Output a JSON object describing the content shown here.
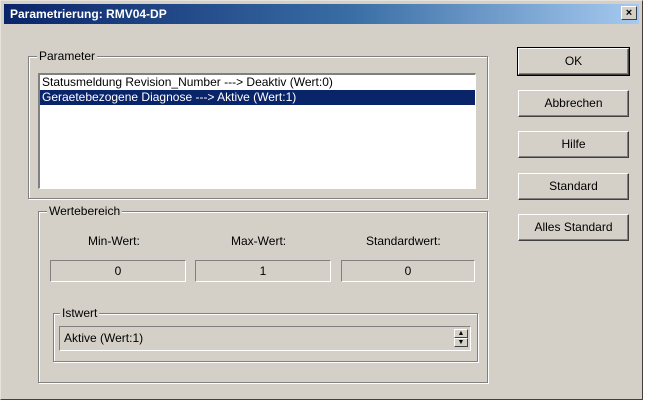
{
  "window": {
    "title": "Parametrierung: RMV04-DP",
    "close_label": "×"
  },
  "parameter_group": {
    "label": "Parameter",
    "items": [
      {
        "text": "Statusmeldung Revision_Number ---> Deaktiv  (Wert:0)",
        "selected": false
      },
      {
        "text": "Geraetebezogene Diagnose ---> Aktive  (Wert:1)",
        "selected": true
      }
    ]
  },
  "wertebereich": {
    "label": "Wertebereich",
    "min_label": "Min-Wert:",
    "max_label": "Max-Wert:",
    "std_label": "Standardwert:",
    "min_value": "0",
    "max_value": "1",
    "std_value": "0"
  },
  "istwert": {
    "label": "Istwert",
    "value": "Aktive  (Wert:1)"
  },
  "buttons": {
    "ok": "OK",
    "cancel": "Abbrechen",
    "help": "Hilfe",
    "standard": "Standard",
    "all_standard": "Alles Standard"
  },
  "colors": {
    "selection": "#0a246a",
    "dialog_bg": "#d4d0c8"
  }
}
